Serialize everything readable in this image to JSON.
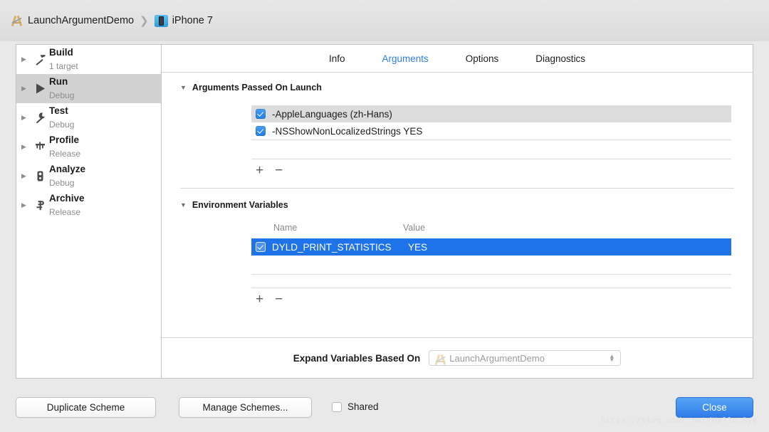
{
  "titlebar": {
    "project_name": "LaunchArgumentDemo",
    "separator": "❯",
    "destination": "iPhone 7",
    "project_icon": "xcode-app-icon",
    "destination_icon": "iphone-simulator-icon"
  },
  "sidebar": {
    "items": [
      {
        "name": "Build",
        "subtitle": "1 target",
        "glyph": "hammer-icon",
        "selected": false
      },
      {
        "name": "Run",
        "subtitle": "Debug",
        "glyph": "play-icon",
        "selected": true
      },
      {
        "name": "Test",
        "subtitle": "Debug",
        "glyph": "wrench-icon",
        "selected": false
      },
      {
        "name": "Profile",
        "subtitle": "Release",
        "glyph": "gauge-icon",
        "selected": false
      },
      {
        "name": "Analyze",
        "subtitle": "Debug",
        "glyph": "microscope-icon",
        "selected": false
      },
      {
        "name": "Archive",
        "subtitle": "Release",
        "glyph": "archive-icon",
        "selected": false
      }
    ]
  },
  "tabs": [
    {
      "label": "Info",
      "active": false
    },
    {
      "label": "Arguments",
      "active": true
    },
    {
      "label": "Options",
      "active": false
    },
    {
      "label": "Diagnostics",
      "active": false
    }
  ],
  "arguments_section": {
    "title": "Arguments Passed On Launch",
    "disclosure": "▼",
    "rows": [
      {
        "checked": true,
        "text": "-AppleLanguages (zh-Hans)",
        "highlighted": true
      },
      {
        "checked": true,
        "text": "-NSShowNonLocalizedStrings YES",
        "highlighted": false
      }
    ],
    "add_label": "+",
    "remove_label": "−"
  },
  "environment_section": {
    "title": "Environment Variables",
    "disclosure": "▼",
    "columns": {
      "name": "Name",
      "value": "Value"
    },
    "rows": [
      {
        "checked": true,
        "name": "DYLD_PRINT_STATISTICS",
        "value": "YES",
        "selected": true
      }
    ],
    "add_label": "+",
    "remove_label": "−"
  },
  "expand_variables": {
    "label": "Expand Variables Based On",
    "selected_value": "LaunchArgumentDemo",
    "icon": "xcode-app-icon"
  },
  "bottom_bar": {
    "duplicate_scheme": "Duplicate Scheme",
    "manage_schemes": "Manage Schemes...",
    "shared_label": "Shared",
    "shared_checked": false,
    "close": "Close"
  },
  "watermark": "https://blog.csdn.net/Hello_Bye",
  "colors": {
    "accent_blue": "#1f73e8",
    "tab_active": "#2f7fe0",
    "selected_row_bg": "#1f73e8",
    "highlight_row_bg": "#dcdcdc",
    "sidebar_selected_bg": "#d2d2d2",
    "window_bg": "#e9e9e9"
  }
}
